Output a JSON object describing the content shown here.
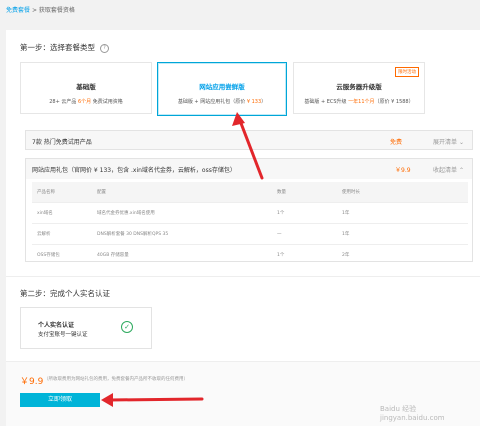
{
  "breadcrumb": {
    "link": "免费套餐",
    "sep": ">",
    "current": "获取套餐资格"
  },
  "step1": {
    "title": "第一步：选择套餐类型",
    "help_icon": "question-circle-icon"
  },
  "cards": [
    {
      "title": "基础版",
      "desc_pre": "28+ 云产品 ",
      "desc_hl": "6个月",
      "desc_post": " 免费试用资格",
      "tag": ""
    },
    {
      "title": "网站应用尝鲜版",
      "desc_pre": "基础版 + 网站应用礼包（原价 ",
      "desc_hl": "¥ 133",
      "desc_post": "）",
      "tag": ""
    },
    {
      "title": "云服务器升级版",
      "desc_pre": "基础版 + ECS升级 ",
      "desc_hl": "一年11个月",
      "desc_post": "（原价 ¥ 1588）",
      "tag": "限时活动"
    }
  ],
  "free_row": {
    "label": "7款 热门免费试用产品",
    "price": "免费",
    "toggle": "展开清单",
    "icon": "chevron-down-icon"
  },
  "gift": {
    "label": "网站应用礼包（官网价 ¥ 133，包含 .xin域名代金券，云解析，oss存储包）",
    "price": "￥9.9",
    "toggle": "收起清单",
    "icon": "chevron-up-icon",
    "headers": [
      "产品名称",
      "配置",
      "数量",
      "使用时长"
    ],
    "rows": [
      [
        "xin域名",
        "域名代金券优惠.xin域名使用",
        "1个",
        "1年"
      ],
      [
        "云解析",
        "DNS解析套餐 30 DNS解析QPS 35",
        "一",
        "1年"
      ],
      [
        "OSS存储包",
        "40GB 存储容量",
        "1个",
        "2年"
      ]
    ]
  },
  "step2": {
    "title": "第二步：完成个人实名认证"
  },
  "verify": {
    "title": "个人实名认证",
    "subtitle": "支付宝账号一键认证",
    "icon": "check-circle-icon"
  },
  "footer": {
    "price": "￥9.9",
    "note": "（所收取费用为网站礼包的费用，免费套餐内产品所不收取的任何费用）",
    "button": "立即领取"
  },
  "colors": {
    "accent": "#00a0e9",
    "button": "#00b4d8",
    "price": "#ff6a00",
    "arrow": "#e2262b"
  },
  "watermark": "Baidu 经验 jingyan.baidu.com"
}
